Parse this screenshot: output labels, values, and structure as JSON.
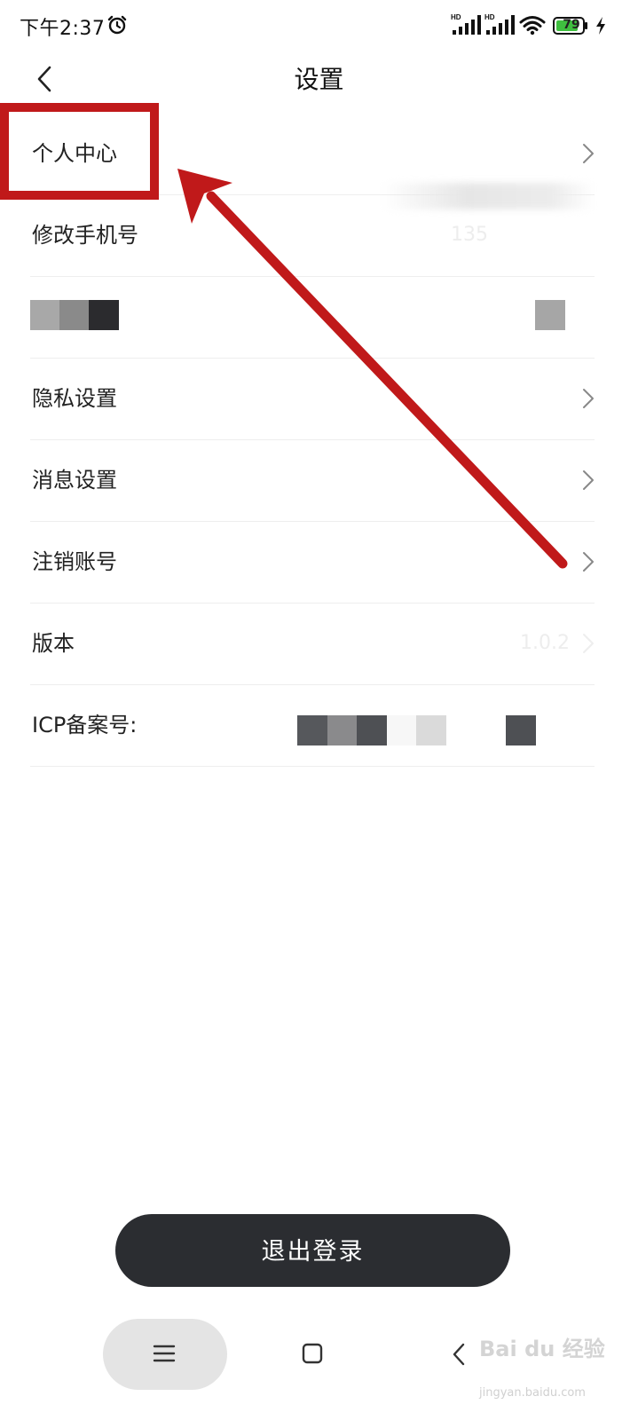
{
  "status_bar": {
    "time": "下午2:37",
    "battery": "79",
    "signal_label": "HD",
    "icons": [
      "alarm-icon",
      "signal-icon",
      "signal-icon",
      "wifi-icon",
      "battery-icon",
      "charging-icon"
    ]
  },
  "header": {
    "title": "设置",
    "back_icon": "chevron-left-icon"
  },
  "settings": {
    "items": [
      {
        "label": "个人中心",
        "chevron": true
      },
      {
        "label": "修改手机号",
        "value": "135",
        "chevron": false
      },
      {
        "label": "",
        "chevron": false
      },
      {
        "label": "隐私设置",
        "chevron": true
      },
      {
        "label": "消息设置",
        "chevron": true
      },
      {
        "label": "注销账号",
        "chevron": true
      },
      {
        "label": "版本",
        "value": "1.0.2",
        "chevron": true
      },
      {
        "label": "ICP备案号:",
        "chevron": false
      }
    ]
  },
  "logout_label": "退出登录",
  "nav": {
    "menu_icon": "menu-icon",
    "home_icon": "square-home-icon",
    "back_icon": "chevron-left-icon"
  },
  "annotation": {
    "color": "#c0191a",
    "highlight": "个人中心"
  },
  "watermark": {
    "text": "Bai du 经验",
    "sub": "jingyan.baidu.com"
  }
}
